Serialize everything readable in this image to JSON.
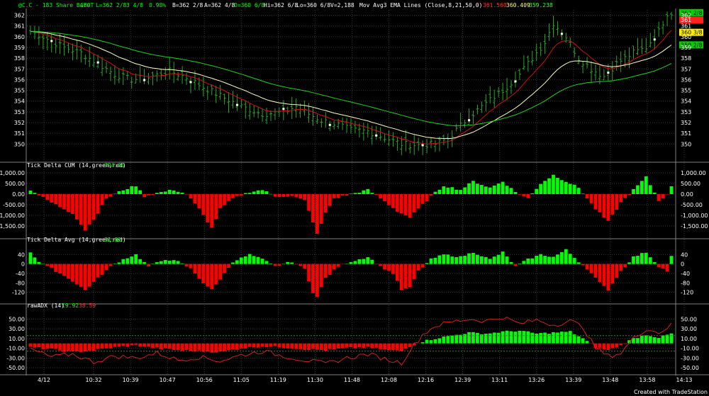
{
  "colors": {
    "background": "#000000",
    "grid": "#3a3a3a",
    "separator": "#808080",
    "text": "#ffffff",
    "bar": "#2aa52a",
    "bar_highlight": "#ffffff",
    "ema_fast": "#d01010",
    "ema_mid": "#ffffc0",
    "ema_slow": "#22d022",
    "hist_pos": "#00ff00",
    "hist_neg": "#ff0000",
    "adx_line": "#d02020",
    "badge_green": "#00d000",
    "badge_red": "#ff2020",
    "badge_yellow": "#ffee00"
  },
  "header": {
    "symbol": "@C.C - 183 Share Bars",
    "exchange": "CBOT",
    "last": "L=362 2/8",
    "change": "3 4/8",
    "change_pct": "0.98%",
    "bid": "B=362 2/8",
    "ask": "A=362 4/8",
    "open": "O=360 6/8",
    "high": "Hi=362 6/8",
    "low": "Lo=360 6/8",
    "volume": "V=2,188",
    "study": "Mov Avg3 EMA Lines (Close,8,21,50,0)",
    "ema_values": [
      "361.560",
      "360.409",
      "359.238"
    ]
  },
  "x_ticks": [
    "4/12",
    "10:32",
    "10:39",
    "10:47",
    "10:56",
    "11:05",
    "11:19",
    "11:30",
    "11:48",
    "12:08",
    "12:16",
    "12:39",
    "13:11",
    "13:26",
    "13:39",
    "13:48",
    "13:58",
    "14:13"
  ],
  "footer": "Created with TradeStation",
  "chart_data": [
    {
      "type": "line",
      "title": "@C.C - 183 Share Bars",
      "subtitle": "OHLC bars with Mov Avg3 EMA Lines (Close,8,21,50,0)",
      "ylim": [
        348.5,
        362.5
      ],
      "y_ticks": [
        "362",
        "361",
        "360",
        "359",
        "358",
        "357",
        "356",
        "355",
        "354",
        "353",
        "352",
        "351",
        "350"
      ],
      "price_anchors": [
        [
          0,
          360.5
        ],
        [
          3,
          360
        ],
        [
          8,
          359
        ],
        [
          12,
          358.5
        ],
        [
          16,
          357.5
        ],
        [
          20,
          356.5
        ],
        [
          24,
          356
        ],
        [
          28,
          356.2
        ],
        [
          33,
          356.8
        ],
        [
          37,
          356.2
        ],
        [
          41,
          355.3
        ],
        [
          45,
          354.5
        ],
        [
          50,
          353.5
        ],
        [
          55,
          352.8
        ],
        [
          60,
          353
        ],
        [
          63,
          353.5
        ],
        [
          66,
          352.8
        ],
        [
          69,
          352.2
        ],
        [
          73,
          351.8
        ],
        [
          76,
          351.3
        ],
        [
          80,
          351.2
        ],
        [
          84,
          350.6
        ],
        [
          88,
          350
        ],
        [
          92,
          349.9
        ],
        [
          96,
          350
        ],
        [
          99,
          350.5
        ],
        [
          104,
          352.5
        ],
        [
          108,
          353.8
        ],
        [
          112,
          355
        ],
        [
          116,
          356.5
        ],
        [
          119,
          358
        ],
        [
          122,
          359.5
        ],
        [
          124,
          361.3
        ],
        [
          127,
          360
        ],
        [
          130,
          358
        ],
        [
          133,
          357
        ],
        [
          136,
          356.3
        ],
        [
          139,
          357.5
        ],
        [
          143,
          358.5
        ],
        [
          146,
          359
        ],
        [
          149,
          360.5
        ],
        [
          151,
          362.2
        ]
      ],
      "series": [
        {
          "name": "EMA 8",
          "last": "361.560",
          "color": "#d01010"
        },
        {
          "name": "EMA 21",
          "last": "360.409",
          "color": "#ffffc0"
        },
        {
          "name": "EMA 50",
          "last": "359.238",
          "color": "#22d022"
        }
      ],
      "last_price_badge": "362 2/8",
      "grid": true
    },
    {
      "type": "bar",
      "title": "Tick Delta CUM (14,green,red)",
      "last_value": "394.00",
      "ylim": [
        -2000,
        1000
      ],
      "y_ticks": [
        "1,000.00",
        "500.00",
        "0.00",
        "-500.00",
        "-1,000.00",
        "-1,500.00"
      ],
      "anchors": [
        [
          0,
          200
        ],
        [
          2,
          -50
        ],
        [
          5,
          -400
        ],
        [
          10,
          -900
        ],
        [
          13,
          -1700
        ],
        [
          16,
          -900
        ],
        [
          18,
          -200
        ],
        [
          20,
          0
        ],
        [
          22,
          200
        ],
        [
          25,
          400
        ],
        [
          27,
          -100
        ],
        [
          30,
          50
        ],
        [
          34,
          200
        ],
        [
          37,
          0
        ],
        [
          40,
          -700
        ],
        [
          43,
          -1600
        ],
        [
          45,
          -700
        ],
        [
          48,
          -200
        ],
        [
          52,
          100
        ],
        [
          55,
          200
        ],
        [
          58,
          -100
        ],
        [
          62,
          -100
        ],
        [
          65,
          -300
        ],
        [
          67,
          -1300
        ],
        [
          68,
          -1900
        ],
        [
          70,
          -900
        ],
        [
          72,
          -200
        ],
        [
          75,
          -50
        ],
        [
          80,
          200
        ],
        [
          83,
          -200
        ],
        [
          87,
          -800
        ],
        [
          90,
          -1100
        ],
        [
          92,
          -700
        ],
        [
          95,
          -100
        ],
        [
          98,
          400
        ],
        [
          102,
          200
        ],
        [
          105,
          600
        ],
        [
          109,
          300
        ],
        [
          112,
          600
        ],
        [
          115,
          100
        ],
        [
          118,
          -200
        ],
        [
          121,
          500
        ],
        [
          124,
          900
        ],
        [
          127,
          600
        ],
        [
          130,
          300
        ],
        [
          134,
          -700
        ],
        [
          137,
          -1300
        ],
        [
          140,
          -400
        ],
        [
          143,
          200
        ],
        [
          146,
          800
        ],
        [
          149,
          -300
        ],
        [
          151,
          -50
        ],
        [
          152,
          394
        ]
      ],
      "grid": true
    },
    {
      "type": "bar",
      "title": "Tick Delta Avg (14,green,red)",
      "last_value": "31.82",
      "ylim": [
        -160,
        80
      ],
      "y_ticks": [
        "40",
        "0",
        "-40",
        "-80",
        "-120"
      ],
      "anchors": [
        [
          0,
          50
        ],
        [
          2,
          10
        ],
        [
          5,
          -20
        ],
        [
          9,
          -60
        ],
        [
          13,
          -110
        ],
        [
          16,
          -60
        ],
        [
          19,
          -10
        ],
        [
          22,
          20
        ],
        [
          25,
          40
        ],
        [
          28,
          -10
        ],
        [
          32,
          20
        ],
        [
          35,
          10
        ],
        [
          38,
          -20
        ],
        [
          41,
          -80
        ],
        [
          43,
          -110
        ],
        [
          46,
          -40
        ],
        [
          48,
          10
        ],
        [
          52,
          40
        ],
        [
          55,
          20
        ],
        [
          58,
          -10
        ],
        [
          62,
          10
        ],
        [
          65,
          -20
        ],
        [
          67,
          -120
        ],
        [
          68,
          -140
        ],
        [
          70,
          -60
        ],
        [
          73,
          -10
        ],
        [
          76,
          10
        ],
        [
          80,
          30
        ],
        [
          83,
          -10
        ],
        [
          86,
          -40
        ],
        [
          88,
          -110
        ],
        [
          90,
          -100
        ],
        [
          92,
          -30
        ],
        [
          95,
          20
        ],
        [
          98,
          40
        ],
        [
          102,
          30
        ],
        [
          105,
          50
        ],
        [
          109,
          20
        ],
        [
          112,
          50
        ],
        [
          115,
          -10
        ],
        [
          118,
          20
        ],
        [
          121,
          40
        ],
        [
          124,
          30
        ],
        [
          127,
          60
        ],
        [
          130,
          10
        ],
        [
          132,
          -20
        ],
        [
          135,
          -80
        ],
        [
          137,
          -110
        ],
        [
          140,
          -30
        ],
        [
          143,
          30
        ],
        [
          146,
          50
        ],
        [
          149,
          -10
        ],
        [
          151,
          -30
        ],
        [
          152,
          32
        ]
      ],
      "grid": true
    },
    {
      "type": "bar",
      "title": "rawADX (14)",
      "values_shown": [
        "19.92",
        "38.59"
      ],
      "ylim": [
        -60,
        65
      ],
      "y_ticks": [
        "50.00",
        "30.00",
        "10.00",
        "-10.00",
        "-30.00",
        "-50.00"
      ],
      "anchors": [
        [
          0,
          -8
        ],
        [
          5,
          -12
        ],
        [
          10,
          -18
        ],
        [
          15,
          -14
        ],
        [
          20,
          -8
        ],
        [
          25,
          -4
        ],
        [
          30,
          -10
        ],
        [
          35,
          -14
        ],
        [
          40,
          -16
        ],
        [
          45,
          -18
        ],
        [
          50,
          -10
        ],
        [
          55,
          -6
        ],
        [
          60,
          -8
        ],
        [
          65,
          -12
        ],
        [
          70,
          -14
        ],
        [
          75,
          -10
        ],
        [
          80,
          -8
        ],
        [
          85,
          -14
        ],
        [
          88,
          -16
        ],
        [
          90,
          -6
        ],
        [
          93,
          4
        ],
        [
          96,
          10
        ],
        [
          100,
          16
        ],
        [
          104,
          22
        ],
        [
          108,
          20
        ],
        [
          112,
          24
        ],
        [
          116,
          26
        ],
        [
          120,
          20
        ],
        [
          124,
          22
        ],
        [
          128,
          24
        ],
        [
          131,
          10
        ],
        [
          134,
          -8
        ],
        [
          137,
          -14
        ],
        [
          140,
          -4
        ],
        [
          143,
          10
        ],
        [
          146,
          18
        ],
        [
          149,
          12
        ],
        [
          152,
          20
        ]
      ],
      "line_anchors": [
        [
          0,
          -12
        ],
        [
          5,
          -28
        ],
        [
          10,
          -22
        ],
        [
          15,
          -38
        ],
        [
          20,
          -26
        ],
        [
          25,
          -30
        ],
        [
          30,
          -20
        ],
        [
          35,
          -34
        ],
        [
          40,
          -28
        ],
        [
          45,
          -36
        ],
        [
          50,
          -24
        ],
        [
          55,
          -16
        ],
        [
          60,
          -26
        ],
        [
          65,
          -34
        ],
        [
          70,
          -42
        ],
        [
          75,
          -30
        ],
        [
          80,
          -22
        ],
        [
          85,
          -34
        ],
        [
          88,
          -40
        ],
        [
          90,
          -14
        ],
        [
          93,
          18
        ],
        [
          96,
          36
        ],
        [
          100,
          44
        ],
        [
          104,
          50
        ],
        [
          108,
          46
        ],
        [
          112,
          54
        ],
        [
          116,
          40
        ],
        [
          120,
          48
        ],
        [
          124,
          38
        ],
        [
          128,
          46
        ],
        [
          131,
          34
        ],
        [
          134,
          -10
        ],
        [
          137,
          -26
        ],
        [
          140,
          -20
        ],
        [
          143,
          10
        ],
        [
          146,
          30
        ],
        [
          149,
          22
        ],
        [
          152,
          38
        ]
      ],
      "reference_levels": [
        16,
        -16
      ],
      "grid": true
    }
  ]
}
